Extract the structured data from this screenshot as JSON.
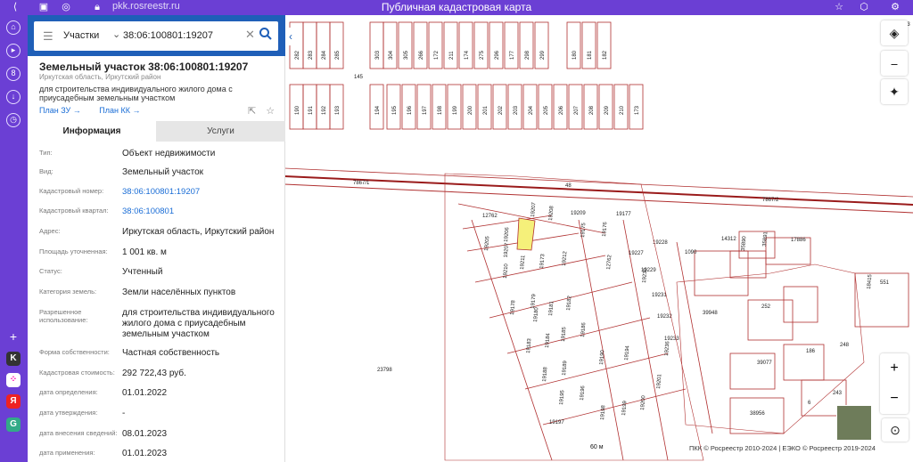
{
  "browser": {
    "url": "pkk.rosreestr.ru",
    "title": "Публичная кадастровая карта"
  },
  "search": {
    "category": "Участки",
    "query": "38:06:100801:19207"
  },
  "object": {
    "title": "Земельный участок 38:06:100801:19207",
    "region": "Иркутская область, Иркутский район",
    "purpose": "для строительства индивидуального жилого дома с приусадебным земельным участком",
    "link_zu": "План ЗУ →",
    "link_kk": "План КК →"
  },
  "tabs": {
    "info": "Информация",
    "services": "Услуги"
  },
  "info": [
    {
      "key": "Тип:",
      "value": "Объект недвижимости"
    },
    {
      "key": "Вид:",
      "value": "Земельный участок"
    },
    {
      "key": "Кадастровый номер:",
      "value": "38:06:100801:19207"
    },
    {
      "key": "Кадастровый квартал:",
      "value": "38:06:100801"
    },
    {
      "key": "Адрес:",
      "value": "Иркутская область, Иркутский район"
    },
    {
      "key": "Площадь уточненная:",
      "value": "1 001 кв. м"
    },
    {
      "key": "Статус:",
      "value": "Учтенный"
    },
    {
      "key": "Категория земель:",
      "value": "Земли населённых пунктов"
    },
    {
      "key": "Разрешенное использование:",
      "value": "для строительства индивидуального жилого дома с приусадебным земельным участком"
    },
    {
      "key": "Форма собственности:",
      "value": "Частная собственность"
    },
    {
      "key": "Кадастровая стоимость:",
      "value": "292 722,43 руб."
    },
    {
      "key": "дата определения:",
      "value": "01.01.2022"
    },
    {
      "key": "дата утверждения:",
      "value": "-"
    },
    {
      "key": "дата внесения сведений:",
      "value": "08.01.2023"
    },
    {
      "key": "дата применения:",
      "value": "01.01.2023"
    }
  ],
  "map": {
    "labels_top_row1": [
      "282",
      "283",
      "284",
      "285",
      "303",
      "304",
      "305",
      "266",
      "172",
      "211",
      "174",
      "275",
      "296",
      "177",
      "298",
      "299",
      "180",
      "181",
      "182"
    ],
    "labels_top_row2": [
      "190",
      "191",
      "192",
      "193",
      "194",
      "195",
      "196",
      "197",
      "198",
      "199",
      "200",
      "201",
      "202",
      "203",
      "204",
      "205",
      "206",
      "207",
      "208",
      "209",
      "210",
      "173"
    ],
    "label_145": "145",
    "road_1": "7867/1",
    "road_2": "7867/2",
    "road_mid": "48",
    "parcels": [
      {
        "t": "12762"
      },
      {
        "t": "19207"
      },
      {
        "t": "19208"
      },
      {
        "t": "19209"
      },
      {
        "t": "19177"
      },
      {
        "t": "19205"
      },
      {
        "t": "19206"
      },
      {
        "t": "19210"
      },
      {
        "t": "19211"
      },
      {
        "t": "19173"
      },
      {
        "t": "19212"
      },
      {
        "t": "19178"
      },
      {
        "t": "19179"
      },
      {
        "t": "19175"
      },
      {
        "t": "19176"
      },
      {
        "t": "12762"
      },
      {
        "t": "19227"
      },
      {
        "t": "19228"
      },
      {
        "t": "19229"
      },
      {
        "t": "19230"
      },
      {
        "t": "19231"
      },
      {
        "t": "19232"
      },
      {
        "t": "19233"
      },
      {
        "t": "19236"
      },
      {
        "t": "19180"
      },
      {
        "t": "19181"
      },
      {
        "t": "19182"
      },
      {
        "t": "19183"
      },
      {
        "t": "19184"
      },
      {
        "t": "19185"
      },
      {
        "t": "19186"
      },
      {
        "t": "19188"
      },
      {
        "t": "19189"
      },
      {
        "t": "19190"
      },
      {
        "t": "19194"
      },
      {
        "t": "19195"
      },
      {
        "t": "19196"
      },
      {
        "t": "19197"
      },
      {
        "t": "19198"
      },
      {
        "t": "19199"
      },
      {
        "t": "19200"
      },
      {
        "t": "19201"
      },
      {
        "t": "23798"
      },
      {
        "t": "1090"
      },
      {
        "t": "14312"
      },
      {
        "t": "35890"
      },
      {
        "t": "35891"
      },
      {
        "t": "17886"
      },
      {
        "t": "18415"
      },
      {
        "t": "39948"
      },
      {
        "t": "252"
      },
      {
        "t": "39077"
      },
      {
        "t": "186"
      },
      {
        "t": "248"
      },
      {
        "t": "243"
      },
      {
        "t": "6"
      },
      {
        "t": "38956"
      },
      {
        "t": "551"
      },
      {
        "t": "63"
      }
    ],
    "scale": "60 м",
    "copyright": "ПКК © Росреестр 2010-2024 | ЕЭКО © Росреестр 2019-2024"
  },
  "colors": {
    "accent": "#6b3fd4",
    "search_bar": "#1f5fb8",
    "parcel_line": "#b03030",
    "selected_parcel": "#f5f07a",
    "link": "#1a6dd6"
  },
  "icons": [
    "search-icon",
    "close-icon",
    "menu-icon",
    "chevron-down-icon",
    "layers-icon",
    "ruler-icon",
    "settings-icon",
    "zoom-in-icon",
    "zoom-out-icon",
    "location-icon",
    "home-icon"
  ]
}
